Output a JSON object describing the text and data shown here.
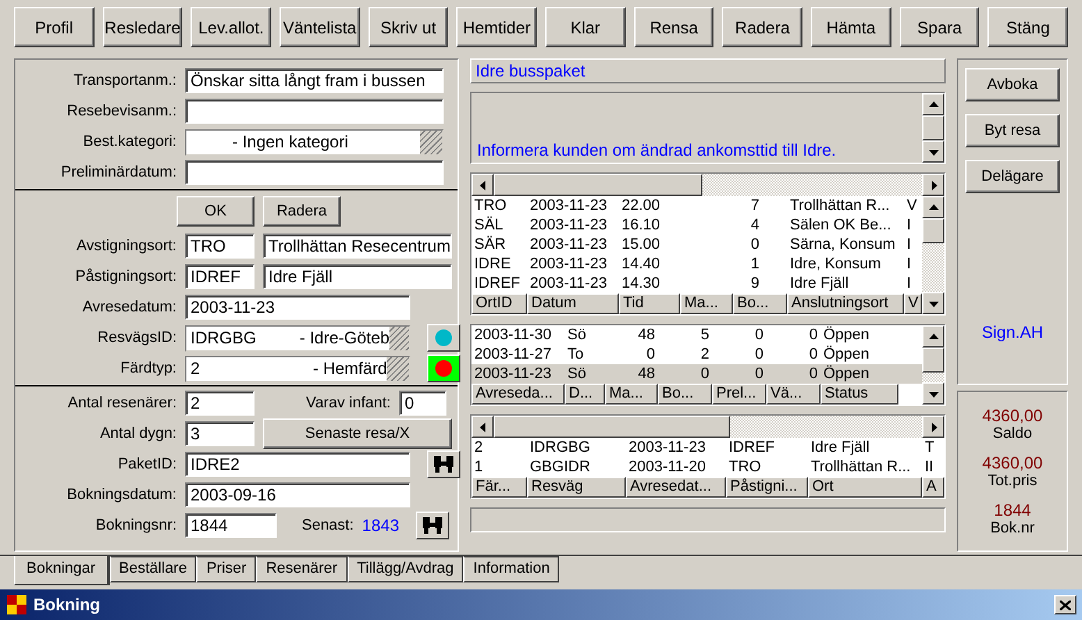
{
  "toolbar": [
    "Profil",
    "Resledare",
    "Lev.allot.",
    "Väntelista",
    "Skriv ut",
    "Hemtider",
    "Klar",
    "Rensa",
    "Radera",
    "Hämta",
    "Spara",
    "Stäng"
  ],
  "notes": {
    "transportanm": {
      "label": "Transportanm.:",
      "value": "Önskar sitta långt fram i bussen"
    },
    "resebevisanm": {
      "label": "Resebevisanm.:"
    },
    "best_kategori": {
      "label": "Best.kategori:",
      "value": "- Ingen kategori"
    },
    "preliminardatum": {
      "label": "Preliminärdatum:"
    }
  },
  "trip": {
    "buttons": [
      "OK",
      "Radera"
    ],
    "avstigningsort": {
      "label": "Avstigningsort:",
      "code": "TRO",
      "name": "Trollhättan Resecentrum"
    },
    "pastigningsort": {
      "label": "Påstigningsort:",
      "code": "IDREF",
      "name": "Idre Fjäll"
    },
    "avresedatum": {
      "label": "Avresedatum:",
      "value": "2003-11-23"
    },
    "resvagsid": {
      "label": "ResvägsID:",
      "code": "IDRGBG",
      "name": "- Idre-Göteb",
      "color": "#00b8c8",
      "highlighted": false
    },
    "fardtyp": {
      "label": "Färdtyp:",
      "code": "2",
      "name": "- Hemfärd",
      "color": "#ff0000",
      "highlighted": true
    }
  },
  "booking": {
    "antal_resenarer": {
      "label": "Antal resenärer:",
      "value": "2"
    },
    "varav_infant": {
      "label": "Varav infant:",
      "value": "0"
    },
    "antal_dygn": {
      "label": "Antal dygn:",
      "value": "3"
    },
    "senaste_resa": "Senaste resa/X",
    "paketid": {
      "label": "PaketID:",
      "value": "IDRE2"
    },
    "bokningsdatum": {
      "label": "Bokningsdatum:",
      "value": "2003-09-16"
    },
    "bokningsnr": {
      "label": "Bokningsnr:",
      "value": "1844"
    },
    "senast": {
      "label": "Senast:",
      "value": "1843"
    }
  },
  "package_name": "Idre busspaket",
  "message": "Informera kunden om ändrad ankomsttid till Idre.",
  "stops_table": {
    "rows": [
      [
        "TRO",
        "2003-11-23",
        "22.00",
        "7",
        "Trollhättan R...",
        "V"
      ],
      [
        "SÄL",
        "2003-11-23",
        "16.10",
        "4",
        "Sälen OK Be...",
        "I"
      ],
      [
        "SÄR",
        "2003-11-23",
        "15.00",
        "0",
        "Särna, Konsum",
        "I"
      ],
      [
        "IDRE",
        "2003-11-23",
        "14.40",
        "1",
        "Idre, Konsum",
        "I"
      ],
      [
        "IDREF",
        "2003-11-23",
        "14.30",
        "9",
        "Idre Fjäll",
        "I"
      ]
    ],
    "header_row": [
      "OrtID",
      "Datum",
      "Tid",
      "Ma...",
      "Bo...",
      "Anslutningsort",
      "V"
    ]
  },
  "departures_table": {
    "rows": [
      {
        "cells": [
          "2003-11-30",
          "Sö",
          "48",
          "5",
          "0",
          "0",
          "Öppen"
        ],
        "selected": false
      },
      {
        "cells": [
          "2003-11-27",
          "To",
          "0",
          "2",
          "0",
          "0",
          "Öppen"
        ],
        "selected": false
      },
      {
        "cells": [
          "2003-11-23",
          "Sö",
          "48",
          "0",
          "0",
          "0",
          "Öppen"
        ],
        "selected": true
      }
    ],
    "header_row": [
      "Avreseda...",
      "D...",
      "Ma...",
      "Bo...",
      "Prel...",
      "Vä...",
      "Status"
    ]
  },
  "trips_table": {
    "rows": [
      [
        "2",
        "IDRGBG",
        "2003-11-23",
        "IDREF",
        "Idre Fjäll",
        "T"
      ],
      [
        "1",
        "GBGIDR",
        "2003-11-20",
        "TRO",
        "Trollhättan R...",
        "II"
      ]
    ],
    "header_row": [
      "Fär...",
      "Resväg",
      "Avresedat...",
      "Påstigni...",
      "Ort",
      "A"
    ]
  },
  "side_buttons": [
    "Avboka",
    "Byt resa",
    "Delägare"
  ],
  "signature": "Sign.AH",
  "summary": [
    {
      "value": "4360,00",
      "label": "Saldo"
    },
    {
      "value": "4360,00",
      "label": "Tot.pris"
    },
    {
      "value": "1844",
      "label": "Bok.nr"
    }
  ],
  "tabs": [
    {
      "label": "Bokningar",
      "selected": true
    },
    {
      "label": "Beställare",
      "selected": false
    },
    {
      "label": "Priser",
      "selected": false
    },
    {
      "label": "Resenärer",
      "selected": false
    },
    {
      "label": "Tillägg/Avdrag",
      "selected": false
    },
    {
      "label": "Information",
      "selected": false
    }
  ],
  "window": {
    "title": "Bokning"
  }
}
